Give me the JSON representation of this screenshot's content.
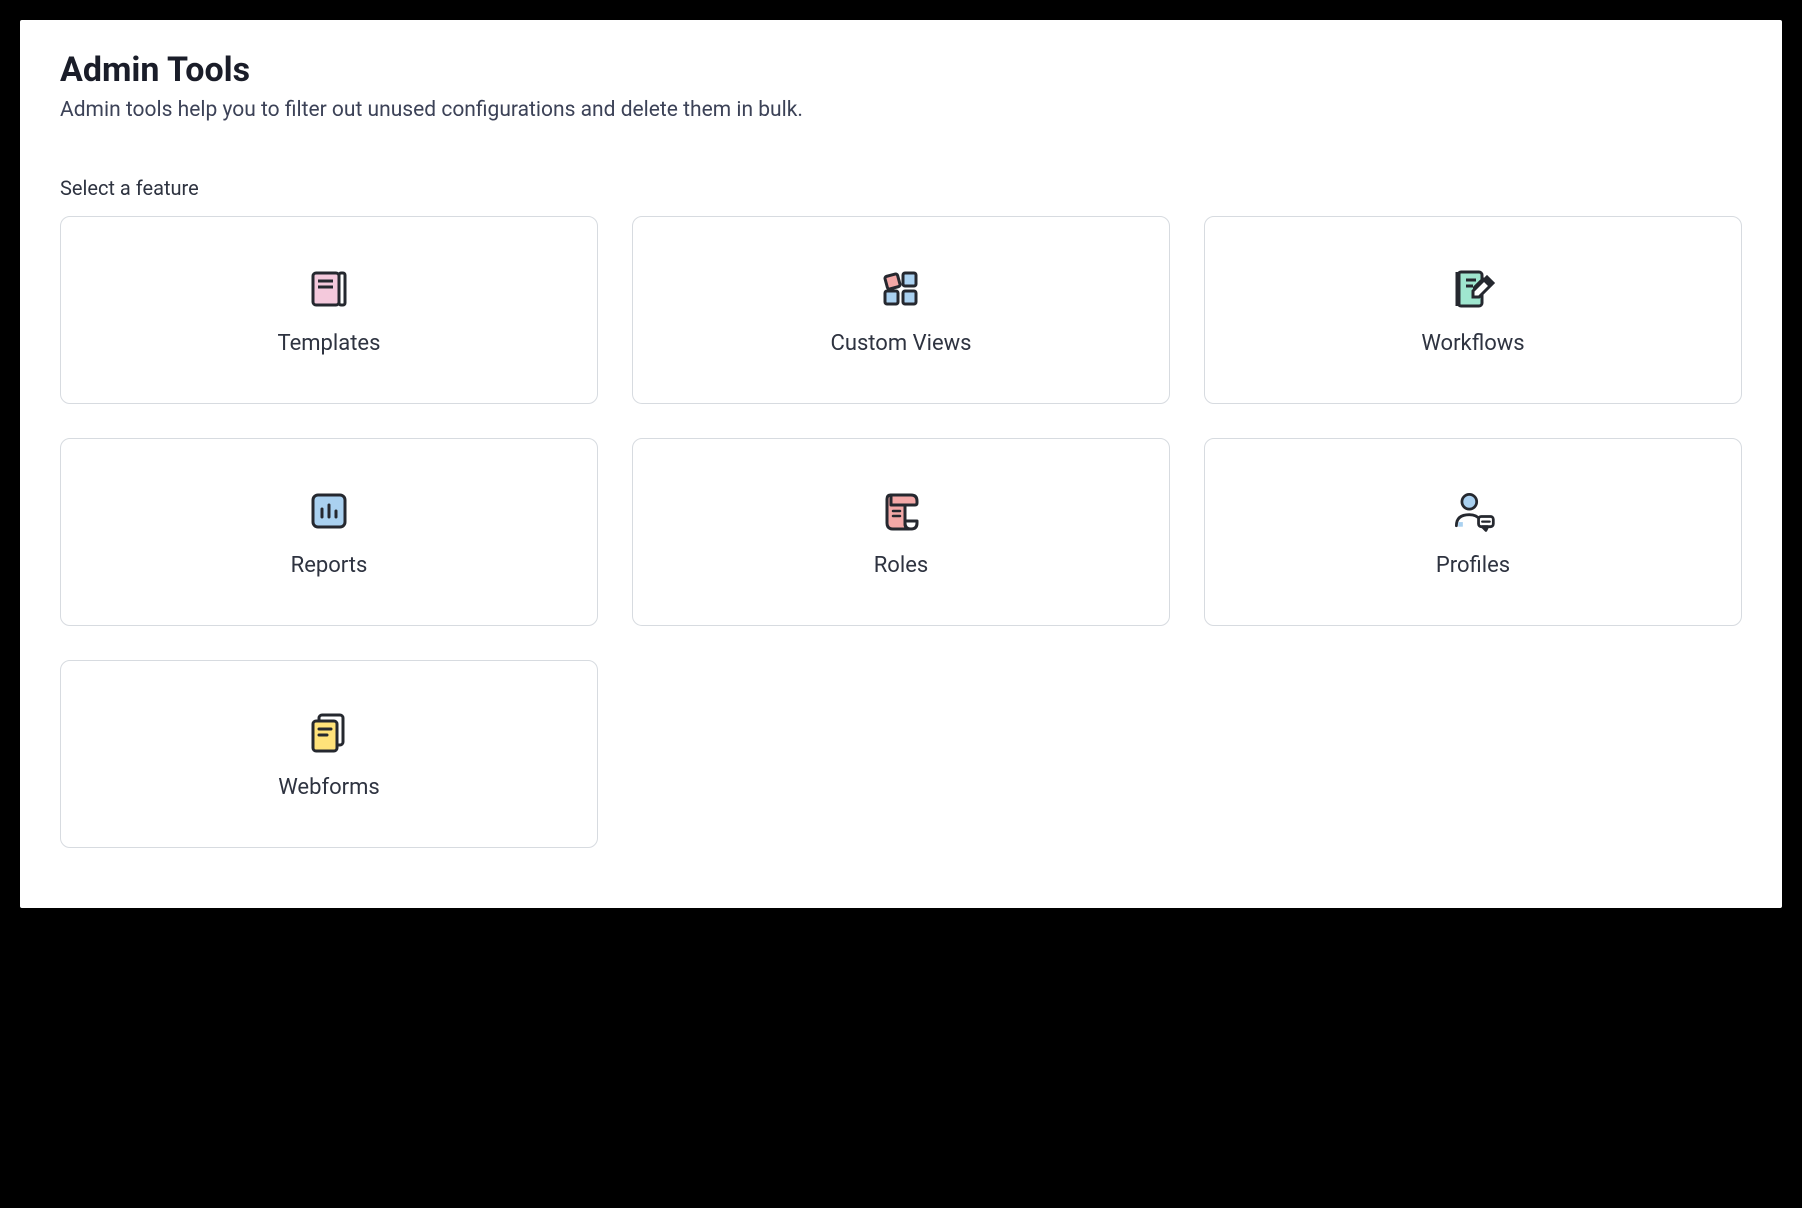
{
  "header": {
    "title": "Admin Tools",
    "subtitle": "Admin tools help you to filter out unused configurations and delete them in bulk."
  },
  "section_label": "Select a feature",
  "features": {
    "templates": {
      "label": "Templates"
    },
    "custom_views": {
      "label": "Custom Views"
    },
    "workflows": {
      "label": "Workflows"
    },
    "reports": {
      "label": "Reports"
    },
    "roles": {
      "label": "Roles"
    },
    "profiles": {
      "label": "Profiles"
    },
    "webforms": {
      "label": "Webforms"
    }
  },
  "colors": {
    "stroke": "#25282f",
    "pink": "#f4c9dc",
    "blue": "#aad1f0",
    "mint": "#9fe6cf",
    "salmon": "#f3a8a7",
    "yellow": "#ffe27a"
  }
}
